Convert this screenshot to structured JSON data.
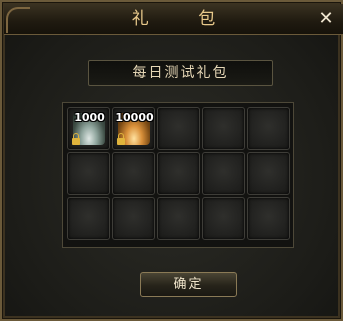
{
  "window": {
    "title": "礼 包",
    "close_symbol": "✕"
  },
  "gift": {
    "name": "每日测试礼包"
  },
  "slots": [
    {
      "item": "silver-coin-pile-icon",
      "quantity": "1000",
      "locked": true
    },
    {
      "item": "gold-coin-pile-icon",
      "quantity": "10000",
      "locked": true
    },
    {
      "item": null
    },
    {
      "item": null
    },
    {
      "item": null
    },
    {
      "item": null
    },
    {
      "item": null
    },
    {
      "item": null
    },
    {
      "item": null
    },
    {
      "item": null
    },
    {
      "item": null
    },
    {
      "item": null
    },
    {
      "item": null
    },
    {
      "item": null
    },
    {
      "item": null
    }
  ],
  "actions": {
    "confirm_label": "确定"
  },
  "colors": {
    "title_text": "#e8c98b",
    "frame_border": "#6b5a3a",
    "gold_coin": "#d9903a",
    "silver_coin": "#8ea49c"
  }
}
